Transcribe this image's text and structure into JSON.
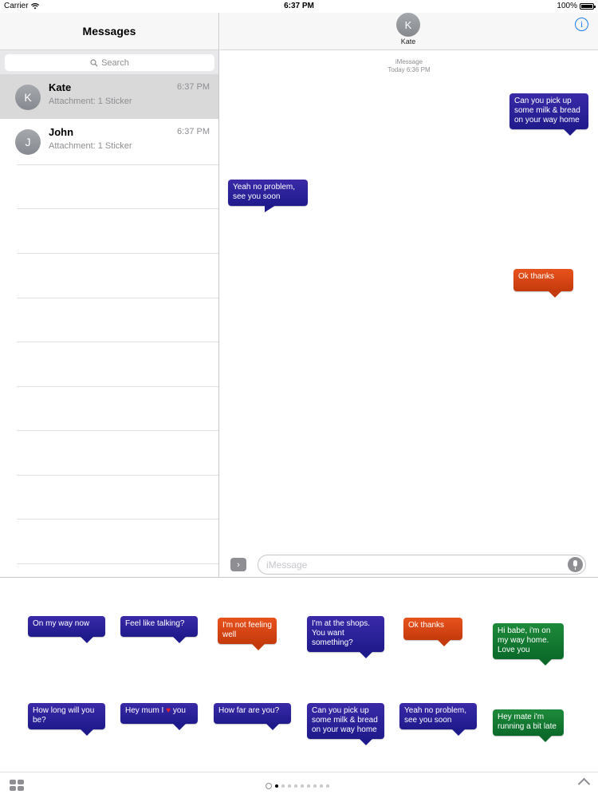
{
  "status_bar": {
    "carrier": "Carrier",
    "time": "6:37 PM",
    "battery": "100%"
  },
  "sidebar": {
    "title": "Messages",
    "search_placeholder": "Search",
    "conversations": [
      {
        "initial": "K",
        "name": "Kate",
        "time": "6:37 PM",
        "preview": "Attachment: 1 Sticker",
        "selected": true
      },
      {
        "initial": "J",
        "name": "John",
        "time": "6:37 PM",
        "preview": "Attachment: 1 Sticker",
        "selected": false
      }
    ]
  },
  "conversation": {
    "contact_initial": "K",
    "contact_name": "Kate",
    "info_glyph": "i",
    "service": "iMessage",
    "timestamp": "Today 6:36 PM",
    "messages": [
      {
        "text": "Can you pick up some milk & bread on your way home",
        "from": "me",
        "color": "blue"
      },
      {
        "text": "Yeah no problem, see you soon",
        "from": "them",
        "color": "blue"
      },
      {
        "text": "Ok thanks",
        "from": "me",
        "color": "orange"
      }
    ]
  },
  "compose": {
    "placeholder": "iMessage",
    "apps_glyph": "›"
  },
  "sticker_drawer": {
    "stickers": [
      {
        "text": "On my way now",
        "color": "blue"
      },
      {
        "text": "Feel like talking?",
        "color": "blue"
      },
      {
        "text": "I'm not feeling well",
        "color": "orange"
      },
      {
        "text": "I'm at the shops. You want something?",
        "color": "blue"
      },
      {
        "text": "Ok thanks",
        "color": "orange"
      },
      {
        "text": "Hi babe, i'm on my way home. Love you",
        "color": "green"
      },
      {
        "text": "How long will you be?",
        "color": "blue"
      },
      {
        "text": "Hey mum I ♥ you",
        "color": "blue"
      },
      {
        "text": "How far are you?",
        "color": "blue"
      },
      {
        "text": "Can you pick up some milk & bread on your way home",
        "color": "blue"
      },
      {
        "text": "Yeah no problem, see you soon",
        "color": "blue"
      },
      {
        "text": "Hey mate i'm running a bit late",
        "color": "green"
      }
    ],
    "page_count": 9,
    "active_page": 0
  },
  "colors": {
    "blue": "#2a1f9c",
    "orange": "#d8461a",
    "green": "#137a32",
    "accent": "#1a7cf6"
  },
  "icons": [
    "wifi-icon",
    "battery-icon",
    "search-icon",
    "info-icon",
    "app-drawer-toggle-icon",
    "microphone-icon",
    "app-grid-icon",
    "recents-clock-icon",
    "chevron-up-icon"
  ]
}
